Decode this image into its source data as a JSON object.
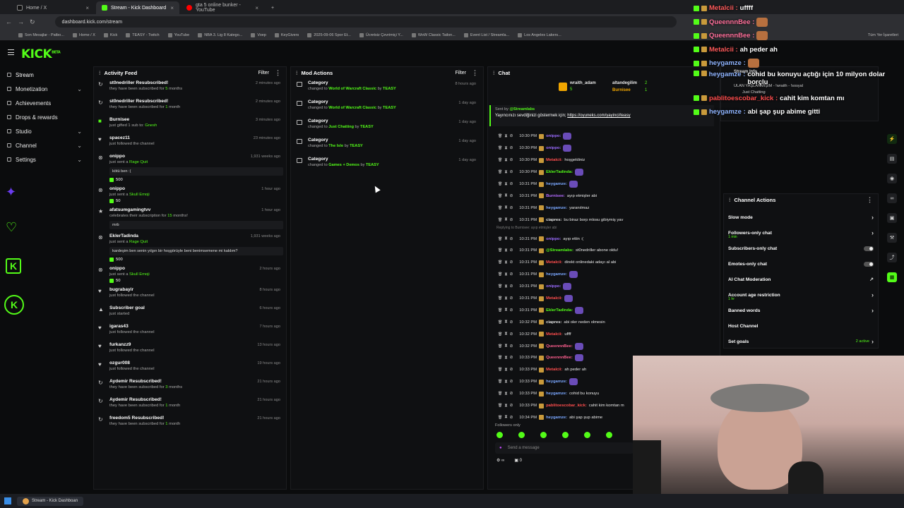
{
  "browser": {
    "tabs": [
      {
        "label": "Home / X",
        "active": false
      },
      {
        "label": "Stream - Kick Dashboard",
        "active": true
      },
      {
        "label": "gta 5 online bunker - YouTube",
        "active": false
      }
    ],
    "url": "dashboard.kick.com/stream",
    "bookmarks": [
      "Son Mesajlar - Patbo...",
      "Home / X",
      "Kick",
      "TEASY - Twitch",
      "YouTube",
      "NBA 3. Lig 8 Katego...",
      "Voep",
      "KeyGivers",
      "2025-09-06 Spor Et...",
      "Ücretsiz Çevrimiçi Y...",
      "WoW Classic Tailon...",
      "Event List / Streamla...",
      "Los Angeles Lakers..."
    ],
    "bookmarks_right": "Tüm Yer İşaretleri"
  },
  "sidebar": {
    "items": [
      {
        "label": "Stream",
        "chevron": false
      },
      {
        "label": "Monetization",
        "chevron": true
      },
      {
        "label": "Achievements",
        "chevron": false
      },
      {
        "label": "Drops & rewards",
        "chevron": false
      },
      {
        "label": "Studio",
        "chevron": true
      },
      {
        "label": "Channel",
        "chevron": true
      },
      {
        "label": "Settings",
        "chevron": true
      }
    ]
  },
  "logo": {
    "text": "KICK",
    "superscript": "BETA"
  },
  "activity_feed": {
    "title": "Activity Feed",
    "filter": "Filter",
    "items": [
      {
        "name": "st0nedriller Resubscribed!",
        "sub_pre": "they have been subscribed for ",
        "sub_hl": "5",
        "sub_post": " months",
        "time": "2 minutes ago"
      },
      {
        "name": "st0nedriller Resubscribed!",
        "sub_pre": "they have been subscribed for ",
        "sub_hl": "1",
        "sub_post": " month",
        "time": "2 minutes ago"
      },
      {
        "name": "Burnisee",
        "sub_pre": "just gifted 1 sub to: ",
        "sub_hl": "Gnesh",
        "sub_post": "",
        "time": "3 minutes ago"
      },
      {
        "name": "spacez11",
        "sub_pre": "just followed the channel",
        "sub_hl": "",
        "sub_post": "",
        "time": "23 minutes ago"
      },
      {
        "name": "onippo",
        "sub_pre": "just sent a ",
        "sub_hl": "Rage Quit",
        "sub_post": "",
        "time": "1,931 weeks ago",
        "bubble": "kötü ben :(",
        "kicks": "500"
      },
      {
        "name": "onippo",
        "sub_pre": "just sent a ",
        "sub_hl": "Skull Emoji",
        "sub_post": "",
        "time": "1 hour ago",
        "kicks": "50"
      },
      {
        "name": "afatsumgamingtvv",
        "sub_pre": "celebrates their subscription for ",
        "sub_hl": "15",
        "sub_post": " months!",
        "time": "1 hour ago",
        "bubble": "mrb"
      },
      {
        "name": "EklerTadinda",
        "sub_pre": "just sent a ",
        "sub_hl": "Rage Quit",
        "sub_post": "",
        "time": "1,931 weeks ago",
        "bubble": "kardeşim ben senin yılgın bir hoşgörüyle beni benimsemene mi kaldım?",
        "kicks": "500"
      },
      {
        "name": "onippo",
        "sub_pre": "just sent a ",
        "sub_hl": "Skull Emoji",
        "sub_post": "",
        "time": "2 hours ago",
        "kicks": "50"
      },
      {
        "name": "bugrabayir",
        "sub_pre": "just followed the channel",
        "sub_hl": "",
        "sub_post": "",
        "time": "8 hours ago"
      },
      {
        "name": "Subscriber goal",
        "sub_pre": "just started",
        "sub_hl": "",
        "sub_post": "",
        "time": "6 hours ago"
      },
      {
        "name": "igaras43",
        "sub_pre": "just followed the channel",
        "sub_hl": "",
        "sub_post": "",
        "time": "7 hours ago"
      },
      {
        "name": "furkanzz9",
        "sub_pre": "just followed the channel",
        "sub_hl": "",
        "sub_post": "",
        "time": "13 hours ago"
      },
      {
        "name": "ozgur008",
        "sub_pre": "just followed the channel",
        "sub_hl": "",
        "sub_post": "",
        "time": "19 hours ago"
      },
      {
        "name": "Aydemir Resubscribed!",
        "sub_pre": "they have been subscribed for ",
        "sub_hl": "3",
        "sub_post": " months",
        "time": "21 hours ago"
      },
      {
        "name": "Aydemir Resubscribed!",
        "sub_pre": "they have been subscribed for ",
        "sub_hl": "1",
        "sub_post": " month",
        "time": "21 hours ago"
      },
      {
        "name": "freedom5 Resubscribed!",
        "sub_pre": "they have been subscribed for ",
        "sub_hl": "1",
        "sub_post": " month",
        "time": "21 hours ago"
      }
    ]
  },
  "mod_actions": {
    "title": "Mod Actions",
    "filter": "Filter",
    "items": [
      {
        "name": "Category",
        "pre": "changed to ",
        "target": "World of Warcraft Classic",
        "by": " by ",
        "user": "TEASY",
        "time": "8 hours ago"
      },
      {
        "name": "Category",
        "pre": "changed to ",
        "target": "World of Warcraft Classic",
        "by": " by ",
        "user": "TEASY",
        "time": "1 day ago"
      },
      {
        "name": "Category",
        "pre": "changed to ",
        "target": "Just Chatting",
        "by": " by ",
        "user": "TEASY",
        "time": "1 day ago"
      },
      {
        "name": "Category",
        "pre": "changed to ",
        "target": "The Isle",
        "by": " by ",
        "user": "TEASY",
        "time": "1 day ago"
      },
      {
        "name": "Category",
        "pre": "changed to ",
        "target": "Games + Demos",
        "by": " by ",
        "user": "TEASY",
        "time": "1 day ago"
      }
    ]
  },
  "chat": {
    "title": "Chat",
    "leaderboard": {
      "first": "wraith_adam",
      "first_count": "5",
      "second": "altandegilim",
      "second_count": "2",
      "third": "Burnisee",
      "third_count": "1"
    },
    "pinned_sender": "Sent by",
    "pinned_user": "@Streamlabs",
    "pinned_text": "Yayıncınızı sevdiğinizi göstermek için; ",
    "pinned_link": "https://oyuneks.com/yayinci/teasy",
    "reply_note": "Replying to Burnisee: ayıp etmişler abi",
    "messages": [
      {
        "time": "10:30 PM",
        "user": "onippo:",
        "color": "#9b6bff",
        "text": ""
      },
      {
        "time": "10:30 PM",
        "user": "onippo:",
        "color": "#9b6bff",
        "text": ""
      },
      {
        "time": "10:30 PM",
        "user": "Metalcii:",
        "color": "#ff4d4d",
        "text": "hoşgeldiniz"
      },
      {
        "time": "10:30 PM",
        "user": "EklerTadinda:",
        "color": "#53fc18",
        "text": ""
      },
      {
        "time": "10:31 PM",
        "user": "heygamze:",
        "color": "#7aa7ff",
        "text": ""
      },
      {
        "time": "10:31 PM",
        "user": "Burnisee:",
        "color": "#b46bff",
        "text": "ayıp etmişler abi"
      },
      {
        "time": "10:31 PM",
        "user": "heygamze:",
        "color": "#7aa7ff",
        "text": "yaranılmaz"
      },
      {
        "time": "10:31 PM",
        "user": "ciapres:",
        "color": "#e0e0e0",
        "text": "bu biraz borp mlosu gibiymiş yav"
      },
      {
        "time": "10:31 PM",
        "user": "onippo:",
        "color": "#9b6bff",
        "text": "ayıp ettin :("
      },
      {
        "time": "10:31 PM",
        "user": "@Streamlabs:",
        "color": "#53fc18",
        "text": "st0nedriller abone oldu!"
      },
      {
        "time": "10:31 PM",
        "user": "Metalcii:",
        "color": "#ff4d4d",
        "text": "direkt onlinedaki adayı al abi"
      },
      {
        "time": "10:31 PM",
        "user": "heygamze:",
        "color": "#7aa7ff",
        "text": ""
      },
      {
        "time": "10:31 PM",
        "user": "onippo:",
        "color": "#9b6bff",
        "text": ""
      },
      {
        "time": "10:31 PM",
        "user": "Metalcii:",
        "color": "#ff4d4d",
        "text": ""
      },
      {
        "time": "10:31 PM",
        "user": "EklerTadinda:",
        "color": "#53fc18",
        "text": ""
      },
      {
        "time": "10:32 PM",
        "user": "ciapres:",
        "color": "#e0e0e0",
        "text": "abi oler neden olmesin"
      },
      {
        "time": "10:32 PM",
        "user": "Metalcii:",
        "color": "#ff4d4d",
        "text": "uffff"
      },
      {
        "time": "10:32 PM",
        "user": "QueennnBee:",
        "color": "#ff5f8f",
        "text": ""
      },
      {
        "time": "10:33 PM",
        "user": "QueennnBee:",
        "color": "#ff5f8f",
        "text": ""
      },
      {
        "time": "10:33 PM",
        "user": "Metalcii:",
        "color": "#ff4d4d",
        "text": "ah peder ah"
      },
      {
        "time": "10:33 PM",
        "user": "heygamze:",
        "color": "#7aa7ff",
        "text": ""
      },
      {
        "time": "10:33 PM",
        "user": "heygamze:",
        "color": "#7aa7ff",
        "text": "cohid bu konuyu"
      },
      {
        "time": "10:33 PM",
        "user": "pablitoescobar_kick:",
        "color": "#ff4d4d",
        "text": "cahit kim komtan m"
      },
      {
        "time": "10:34 PM",
        "user": "heygamze:",
        "color": "#7aa7ff",
        "text": "abi şap şup abime"
      }
    ],
    "mode": "Followers only",
    "placeholder": "Send a message",
    "viewers": "0"
  },
  "channel_actions": {
    "title": "Channel Actions",
    "rows": [
      {
        "label": "Slow mode",
        "sub": "",
        "type": "chevron"
      },
      {
        "label": "Followers-only chat",
        "sub": "1 min",
        "type": "chevron"
      },
      {
        "label": "Subscribers-only chat",
        "sub": "",
        "type": "toggle"
      },
      {
        "label": "Emotes-only chat",
        "sub": "",
        "type": "toggle"
      },
      {
        "label": "AI Chat Moderation",
        "sub": "",
        "type": "external"
      },
      {
        "label": "Account age restriction",
        "sub": "1 hr",
        "type": "chevron"
      },
      {
        "label": "Banned words",
        "sub": "",
        "type": "chevron"
      },
      {
        "label": "Host Channel",
        "sub": "",
        "type": "none"
      },
      {
        "label": "Set goals",
        "sub": "",
        "type": "goals",
        "extra": "2 active"
      }
    ]
  },
  "stream_info": {
    "title": "Stream Info",
    "line1": "ULAN YAŞLANMIŞIM - !wraith - !sosyal",
    "line2": "Just Chatting"
  },
  "overlay_chat": [
    {
      "user": "Metalcii :",
      "color": "#ff5a5a",
      "text": "uffff"
    },
    {
      "user": "QueennnBee :",
      "color": "#ff6f9a",
      "text": ""
    },
    {
      "user": "QueennnBee :",
      "color": "#ff6f9a",
      "text": ""
    },
    {
      "user": "Metalcii :",
      "color": "#ff5a5a",
      "text": "ah peder ah"
    },
    {
      "user": "heygamze :",
      "color": "#8fb4ff",
      "text": ""
    },
    {
      "user": "heygamze :",
      "color": "#8fb4ff",
      "text": "cohid bu konuyu açtığı için 10 milyon dolar borçlu"
    },
    {
      "user": "pablitoescobar_kick :",
      "color": "#ff4d4d",
      "text": "cahit kim komtan mı"
    },
    {
      "user": "heygamze :",
      "color": "#8fb4ff",
      "text": "abi şap şup abime gitti"
    }
  ],
  "taskbar": {
    "app_label": "Stream - Kick Dashboan"
  }
}
